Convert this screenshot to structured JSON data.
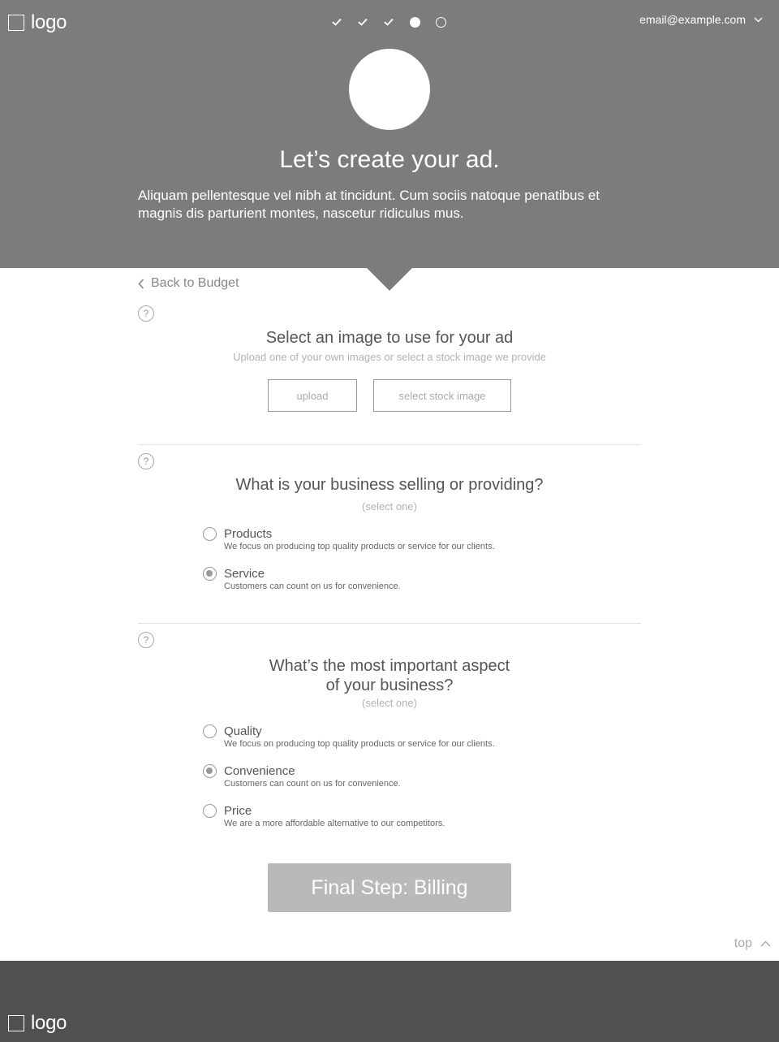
{
  "header": {
    "logo_text": "logo",
    "account_email": "email@example.com",
    "steps": [
      "complete",
      "complete",
      "complete",
      "current",
      "upcoming"
    ],
    "title": "Let’s create your ad.",
    "intro": "Aliquam pellentesque vel nibh at tincidunt. Cum sociis natoque penatibus et magnis dis parturient montes, nascetur ridiculus mus."
  },
  "nav": {
    "back_label": "Back to Budget"
  },
  "image_section": {
    "help_glyph": "?",
    "title": "Select an image to use for your ad",
    "subtitle": "Upload one of your own images or select a stock image we provide",
    "upload_label": "upload",
    "stock_label": "select stock image"
  },
  "business_section": {
    "help_glyph": "?",
    "title": "What is your business selling or providing?",
    "hint": "(select one)",
    "options": [
      {
        "label": "Products",
        "description": "We focus on producing top quality products or service for our clients.",
        "selected": false
      },
      {
        "label": "Service",
        "description": "Customers can count on us for convenience.",
        "selected": true
      }
    ]
  },
  "aspect_section": {
    "help_glyph": "?",
    "title_line1": "What’s the most important aspect",
    "title_line2": "of your business?",
    "hint": "(select one)",
    "options": [
      {
        "label": "Quality",
        "description": "We focus on producing top quality products or service for our clients.",
        "selected": false
      },
      {
        "label": "Convenience",
        "description": "Customers can count on us for convenience.",
        "selected": true
      },
      {
        "label": "Price",
        "description": "We are a more affordable alternative to our competitors.",
        "selected": false
      }
    ]
  },
  "cta": {
    "label": "Final Step: Billing"
  },
  "back_to_top": {
    "label": "top"
  },
  "footer": {
    "logo_text": "logo"
  },
  "colors": {
    "header_bg": "#7c7c7c",
    "footer_bg": "#505050",
    "cta_bg": "#b9b9b9"
  }
}
